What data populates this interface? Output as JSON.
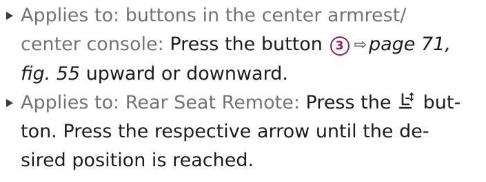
{
  "items": [
    {
      "lines": [
        {
          "prefix": "Applies to: buttons in the center armrest/"
        },
        {
          "prefix": "center console:",
          "text": " Press the button",
          "callout_number": "3",
          "link": "page 71,"
        },
        {
          "link": "fig. 55",
          "text": " upward or downward."
        }
      ],
      "bullet_icon": "triangle-bullet-icon",
      "arrow_icon": "page-reference-arrow-icon"
    },
    {
      "lines": [
        {
          "prefix": "Applies to: Rear Seat Remote:",
          "text_before_icon": " Press the",
          "text_after_icon": " but-"
        },
        {
          "text": "ton. Press the respective arrow until the de-"
        },
        {
          "text": "sired position is reached."
        }
      ],
      "bullet_icon": "triangle-bullet-icon",
      "button_icon": "seat-adjust-icon"
    }
  ],
  "colors": {
    "prefix": "#737373",
    "body": "#1c1c1c",
    "callout": "#9b1b5a"
  }
}
